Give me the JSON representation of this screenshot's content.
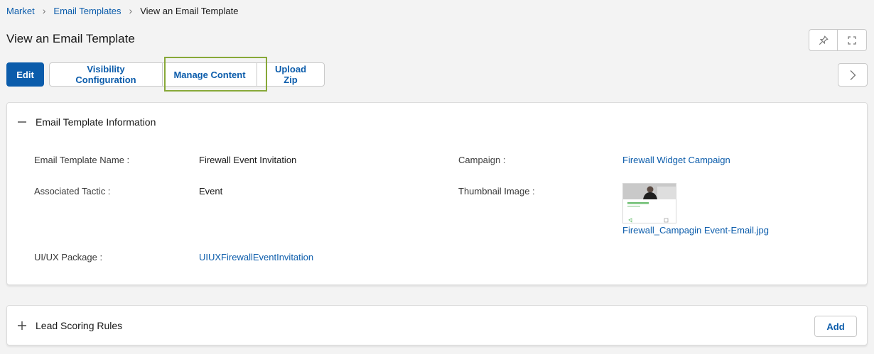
{
  "breadcrumb": {
    "items": [
      "Market",
      "Email Templates"
    ],
    "current": "View an Email Template"
  },
  "page": {
    "title": "View an Email Template"
  },
  "toolbar": {
    "edit_label": "Edit",
    "visibility_label": "Visibility Configuration",
    "manage_content_label": "Manage Content",
    "upload_zip_label": "Upload Zip"
  },
  "icons": {
    "pin": "pin-icon",
    "fullscreen": "fullscreen-icon",
    "next": "chevron-right-icon",
    "collapse": "minus-icon",
    "expand": "plus-icon"
  },
  "colors": {
    "brand": "#0b5cab",
    "highlight": "#87a838"
  },
  "info_section": {
    "title": "Email Template Information",
    "fields": {
      "name_label": "Email Template Name :",
      "name_value": "Firewall Event Invitation",
      "campaign_label": "Campaign :",
      "campaign_value": "Firewall Widget Campaign",
      "tactic_label": "Associated Tactic :",
      "tactic_value": "Event",
      "thumbnail_label": "Thumbnail Image :",
      "thumbnail_file": "Firewall_Campagin Event-Email.jpg",
      "package_label": "UI/UX Package :",
      "package_value": "UIUXFirewallEventInvitation"
    }
  },
  "lead_section": {
    "title": "Lead Scoring Rules",
    "add_label": "Add"
  }
}
